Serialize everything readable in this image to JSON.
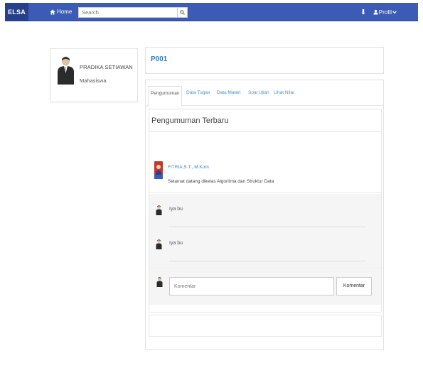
{
  "navbar": {
    "brand": "ELSA",
    "home_label": "Home",
    "search_placeholder": "Search",
    "profile_label": "Profil",
    "accent": "#3b5bb5"
  },
  "profile": {
    "name": "PRADIKA SETIAWAN",
    "role": "Mahasiswa"
  },
  "course": {
    "code": "P001"
  },
  "tabs": [
    {
      "label": "Pengumuman",
      "active": true
    },
    {
      "label": "Data Tugas"
    },
    {
      "label": "Data Materi"
    },
    {
      "label": "Soal Ujian"
    },
    {
      "label": "Lihat Nilai"
    }
  ],
  "announcements": {
    "heading": "Pengumuman Terbaru",
    "author": "FITRIA,S.T., M.Kom",
    "text": "Selamat datang dikelas Algoritma dan Struktur Data"
  },
  "comments": [
    {
      "text": "Iya bu"
    },
    {
      "text": "Iya bu"
    }
  ],
  "comment_form": {
    "placeholder": "Komentar",
    "button_label": "Komentar"
  }
}
